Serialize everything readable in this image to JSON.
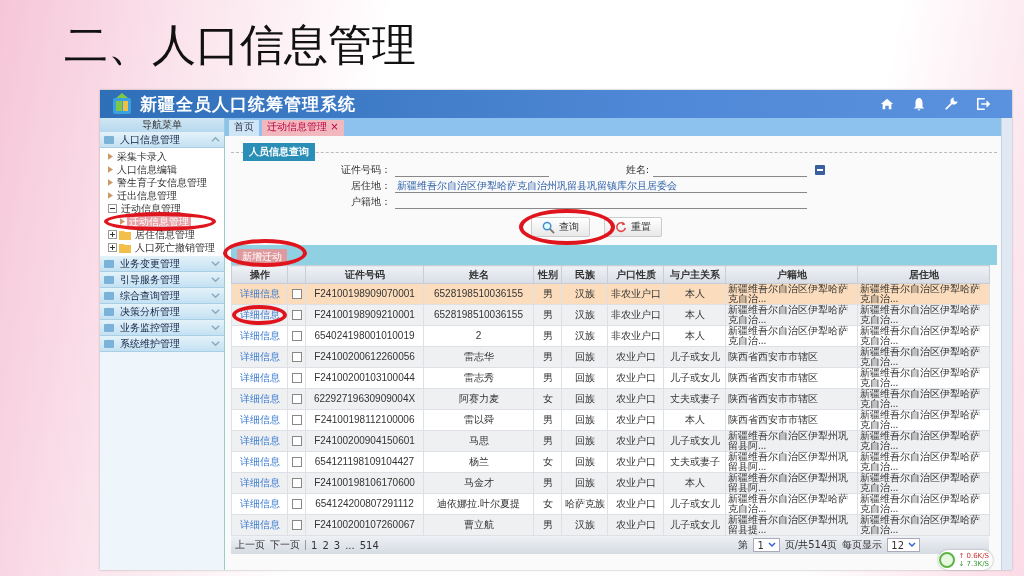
{
  "slide_title": "二、人口信息管理",
  "app": {
    "title": "新疆全员人口统筹管理系统"
  },
  "tabs": [
    {
      "label": "首页",
      "selected": false
    },
    {
      "label": "迁动信息管理 ×",
      "selected": true
    }
  ],
  "sidebar": {
    "title": "导航菜单",
    "sections": [
      {
        "label": "人口信息管理",
        "expanded": true,
        "nodes": [
          {
            "label": "采集卡录入",
            "kind": "leaf",
            "selected": false
          },
          {
            "label": "人口信息编辑",
            "kind": "leaf",
            "selected": false
          },
          {
            "label": "警生育子女信息管理",
            "kind": "leaf",
            "selected": false
          },
          {
            "label": "迁出信息管理",
            "kind": "leaf",
            "selected": false
          },
          {
            "label": "迁动信息管理",
            "kind": "folder",
            "expanded": true,
            "selected": false,
            "children": [
              {
                "label": "迁动信息管理",
                "selected": true,
                "circled": true
              }
            ]
          },
          {
            "label": "居住信息管理",
            "kind": "folder",
            "expanded": false,
            "selected": false
          },
          {
            "label": "人口死亡撤销管理",
            "kind": "folder",
            "expanded": false,
            "selected": false
          }
        ]
      },
      {
        "label": "业务变更管理",
        "expanded": false
      },
      {
        "label": "引导服务管理",
        "expanded": false
      },
      {
        "label": "综合查询管理",
        "expanded": false
      },
      {
        "label": "决策分析管理",
        "expanded": false
      },
      {
        "label": "业务监控管理",
        "expanded": false
      },
      {
        "label": "系统维护管理",
        "expanded": false
      }
    ]
  },
  "query": {
    "legend": "人员信息查询",
    "fields": [
      {
        "label": "证件号码："
      },
      {
        "label": "姓名:"
      },
      {
        "label": "居住地：",
        "value": "新疆维吾尔自治区伊犁哈萨克自治州巩留县巩留镇库尔且居委会"
      },
      {
        "label": "户籍地："
      }
    ],
    "search_button": {
      "label": "查询",
      "circled": true
    },
    "reset_button": {
      "label": "重置"
    }
  },
  "toolbar": {
    "add_button": {
      "label": "新增迁动",
      "circled": true
    }
  },
  "table": {
    "columns": [
      "操作",
      "",
      "证件号码",
      "姓名",
      "性别",
      "民族",
      "户口性质",
      "与户主关系",
      "户籍地",
      "居住地"
    ],
    "rows": [
      {
        "checked": false,
        "selected": true,
        "circled": false,
        "cells": [
          "详细信息",
          "",
          "F24100198909070001",
          "6528198510036155",
          "男",
          "汉族",
          "非农业户口",
          "本人",
          "新疆维吾尔自治区伊犁哈萨克自治...",
          "新疆维吾尔自治区伊犁哈萨克自治..."
        ]
      },
      {
        "checked": false,
        "selected": false,
        "circled": true,
        "cells": [
          "详细信息",
          "",
          "F24100198909210001",
          "6528198510036155",
          "男",
          "汉族",
          "非农业户口",
          "本人",
          "新疆维吾尔自治区伊犁哈萨克自治...",
          "新疆维吾尔自治区伊犁哈萨克自治..."
        ]
      },
      {
        "checked": false,
        "selected": false,
        "circled": false,
        "cells": [
          "详细信息",
          "",
          "654024198001010019",
          "2",
          "男",
          "汉族",
          "非农业户口",
          "本人",
          "新疆维吾尔自治区伊犁哈萨克自治...",
          "新疆维吾尔自治区伊犁哈萨克自治..."
        ]
      },
      {
        "checked": false,
        "selected": false,
        "circled": false,
        "cells": [
          "详细信息",
          "",
          "F24100200612260056",
          "雷志华",
          "男",
          "回族",
          "农业户口",
          "儿子或女儿",
          "陕西省西安市市辖区",
          "新疆维吾尔自治区伊犁哈萨克自治..."
        ]
      },
      {
        "checked": false,
        "selected": false,
        "circled": false,
        "cells": [
          "详细信息",
          "",
          "F24100200103100044",
          "雷志秀",
          "男",
          "回族",
          "农业户口",
          "儿子或女儿",
          "陕西省西安市市辖区",
          "新疆维吾尔自治区伊犁哈萨克自治..."
        ]
      },
      {
        "checked": false,
        "selected": false,
        "circled": false,
        "cells": [
          "详细信息",
          "",
          "62292719630909004X",
          "阿赛力麦",
          "女",
          "回族",
          "农业户口",
          "丈夫或妻子",
          "陕西省西安市市辖区",
          "新疆维吾尔自治区伊犁哈萨克自治..."
        ]
      },
      {
        "checked": false,
        "selected": false,
        "circled": false,
        "cells": [
          "详细信息",
          "",
          "F24100198112100006",
          "雷以舜",
          "男",
          "回族",
          "农业户口",
          "本人",
          "陕西省西安市市辖区",
          "新疆维吾尔自治区伊犁哈萨克自治..."
        ]
      },
      {
        "checked": false,
        "selected": false,
        "circled": false,
        "cells": [
          "详细信息",
          "",
          "F24100200904150601",
          "马思",
          "男",
          "回族",
          "农业户口",
          "儿子或女儿",
          "新疆维吾尔自治区伊犁州巩留县阿...",
          "新疆维吾尔自治区伊犁哈萨克自治..."
        ]
      },
      {
        "checked": false,
        "selected": false,
        "circled": false,
        "cells": [
          "详细信息",
          "",
          "654121198109104427",
          "杨兰",
          "女",
          "回族",
          "农业户口",
          "丈夫或妻子",
          "新疆维吾尔自治区伊犁州巩留县阿...",
          "新疆维吾尔自治区伊犁哈萨克自治..."
        ]
      },
      {
        "checked": false,
        "selected": false,
        "circled": false,
        "cells": [
          "详细信息",
          "",
          "F24100198106170600",
          "马金才",
          "男",
          "回族",
          "农业户口",
          "本人",
          "新疆维吾尔自治区伊犁州巩留县阿...",
          "新疆维吾尔自治区伊犁哈萨克自治..."
        ]
      },
      {
        "checked": false,
        "selected": false,
        "circled": false,
        "cells": [
          "详细信息",
          "",
          "654124200807291112",
          "迪依娜拉.叶尔夏提",
          "女",
          "哈萨克族",
          "农业户口",
          "儿子或女儿",
          "新疆维吾尔自治区伊犁哈萨克自治...",
          "新疆维吾尔自治区伊犁哈萨克自治..."
        ]
      },
      {
        "checked": false,
        "selected": false,
        "circled": false,
        "cells": [
          "详细信息",
          "",
          "F24100200107260067",
          "曹立航",
          "男",
          "汉族",
          "农业户口",
          "儿子或女儿",
          "新疆维吾尔自治区伊犁州巩留县提...",
          "新疆维吾尔自治区伊犁哈萨克自治..."
        ]
      }
    ]
  },
  "pager": {
    "prev": "上一页",
    "next": "下一页",
    "pages": [
      "1",
      "2",
      "3",
      "...",
      "514"
    ],
    "page_prefix": "第",
    "page_value": "1",
    "page_suffix": "页/共514页",
    "size_label": "每页显示",
    "size_value": "12"
  },
  "speed_widget": {
    "upload": "↑ 0.6K/S",
    "download": "↓ 7.3K/S"
  }
}
